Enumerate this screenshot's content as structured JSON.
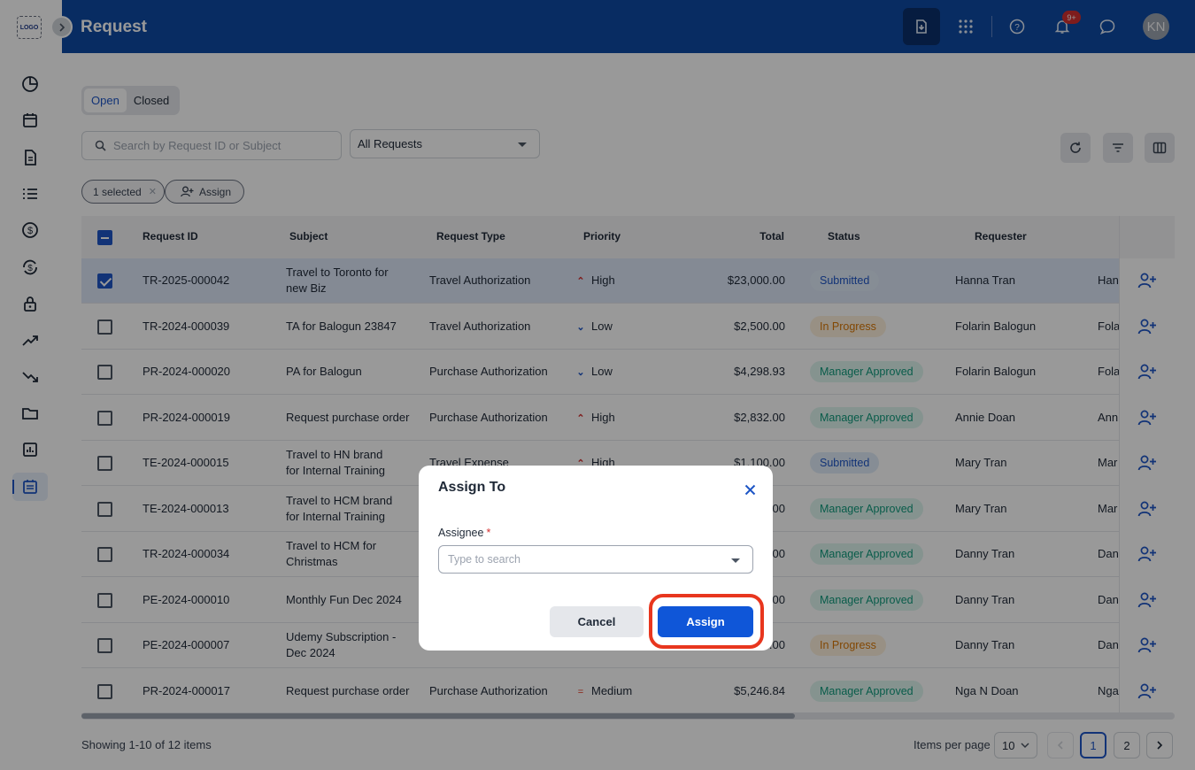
{
  "app": {
    "logo_text": "LOGO",
    "page_title": "Request"
  },
  "header": {
    "notification_count": "9+",
    "avatar_initials": "KN"
  },
  "tabs": [
    {
      "label": "Open"
    },
    {
      "label": "Closed"
    }
  ],
  "filters": {
    "search_placeholder": "Search by Request ID or Subject",
    "request_filter": "All Requests"
  },
  "selection": {
    "chip_label": "1 selected",
    "assign_label": "Assign"
  },
  "table": {
    "columns": [
      "Request ID",
      "Subject",
      "Request Type",
      "Priority",
      "Total",
      "Status",
      "Requester"
    ],
    "rows": [
      {
        "id": "TR-2025-000042",
        "subject": "Travel to Toronto for new Biz",
        "type": "Travel Authorization",
        "priority": "High",
        "total": "$23,000.00",
        "status": "Submitted",
        "requester": "Hanna Tran",
        "extra": "Han",
        "selected": true
      },
      {
        "id": "TR-2024-000039",
        "subject": "TA for Balogun 23847",
        "type": "Travel Authorization",
        "priority": "Low",
        "total": "$2,500.00",
        "status": "In Progress",
        "requester": "Folarin Balogun",
        "extra": "Fola",
        "selected": false
      },
      {
        "id": "PR-2024-000020",
        "subject": "PA for Balogun",
        "type": "Purchase Authorization",
        "priority": "Low",
        "total": "$4,298.93",
        "status": "Manager Approved",
        "requester": "Folarin Balogun",
        "extra": "Fola",
        "selected": false
      },
      {
        "id": "PR-2024-000019",
        "subject": "Request purchase order",
        "type": "Purchase Authorization",
        "priority": "High",
        "total": "$2,832.00",
        "status": "Manager Approved",
        "requester": "Annie Doan",
        "extra": "Anni",
        "selected": false
      },
      {
        "id": "TE-2024-000015",
        "subject": "Travel to HN brand for Internal Training",
        "type": "Travel Expense",
        "priority": "High",
        "total": "$1,100.00",
        "status": "Submitted",
        "requester": "Mary Tran",
        "extra": "Mar",
        "selected": false
      },
      {
        "id": "TE-2024-000013",
        "subject": "Travel to HCM brand for Internal Training",
        "type": "",
        "priority": "",
        "total": ".00",
        "status": "Manager Approved",
        "requester": "Mary Tran",
        "extra": "Mar",
        "selected": false
      },
      {
        "id": "TR-2024-000034",
        "subject": "Travel to HCM for Christmas",
        "type": "",
        "priority": "",
        "total": ".00",
        "status": "Manager Approved",
        "requester": "Danny Tran",
        "extra": "Dan",
        "selected": false
      },
      {
        "id": "PE-2024-000010",
        "subject": "Monthly Fun Dec 2024",
        "type": "",
        "priority": "",
        "total": ".00",
        "status": "Manager Approved",
        "requester": "Danny Tran",
        "extra": "Dan",
        "selected": false
      },
      {
        "id": "PE-2024-000007",
        "subject": "Udemy Subscription - Dec 2024",
        "type": "",
        "priority": "",
        "total": ".00",
        "status": "In Progress",
        "requester": "Danny Tran",
        "extra": "Dan",
        "selected": false
      },
      {
        "id": "PR-2024-000017",
        "subject": "Request purchase order",
        "type": "Purchase Authorization",
        "priority": "Medium",
        "total": "$5,246.84",
        "status": "Manager Approved",
        "requester": "Nga N Doan",
        "extra": "Nga",
        "selected": false
      }
    ]
  },
  "pagination": {
    "showing": "Showing 1-10 of 12 items",
    "items_per_page_label": "Items per page",
    "items_per_page": "10",
    "pages": [
      "1",
      "2"
    ]
  },
  "dialog": {
    "title": "Assign To",
    "assignee_label": "Assignee",
    "required_mark": "*",
    "assignee_placeholder": "Type to search",
    "cancel_label": "Cancel",
    "assign_label": "Assign"
  },
  "colors": {
    "header": "#0e4aa3",
    "accent": "#1e56c6",
    "assign_button": "#0f56d8",
    "highlight": "#e8361e"
  }
}
